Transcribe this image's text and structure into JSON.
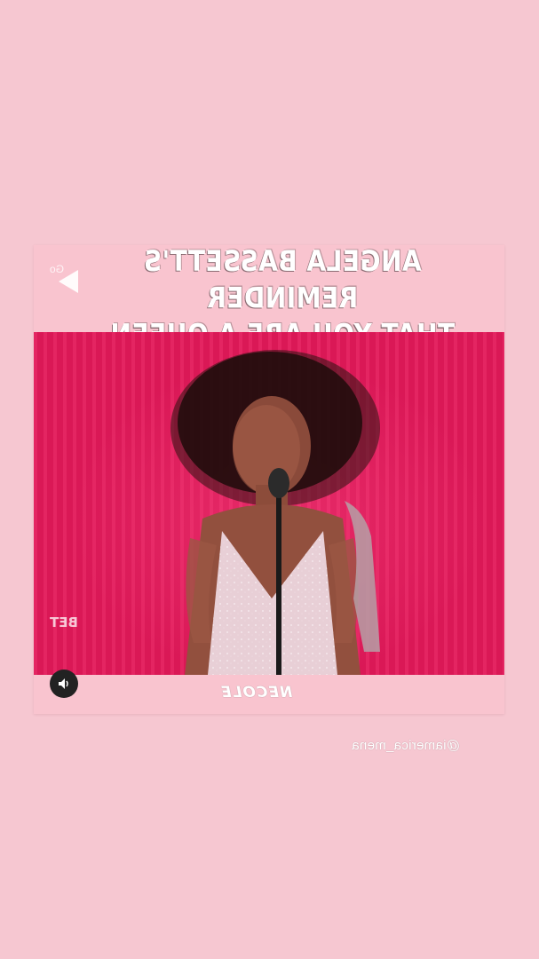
{
  "story": {
    "background_color": "#f6c7d1",
    "mention": "@iamerica_mena"
  },
  "post": {
    "headline_line1": "ANGELA BASSETT'S REMINDER",
    "headline_line2": "THAT YOU ARE A QUEEN",
    "back_label": "Go",
    "video_watermark": "BET",
    "brand": "NECOLE",
    "video_bg_color": "#e3195a",
    "icons": {
      "back": "back-arrow-icon",
      "mute": "speaker-muted-icon"
    }
  }
}
